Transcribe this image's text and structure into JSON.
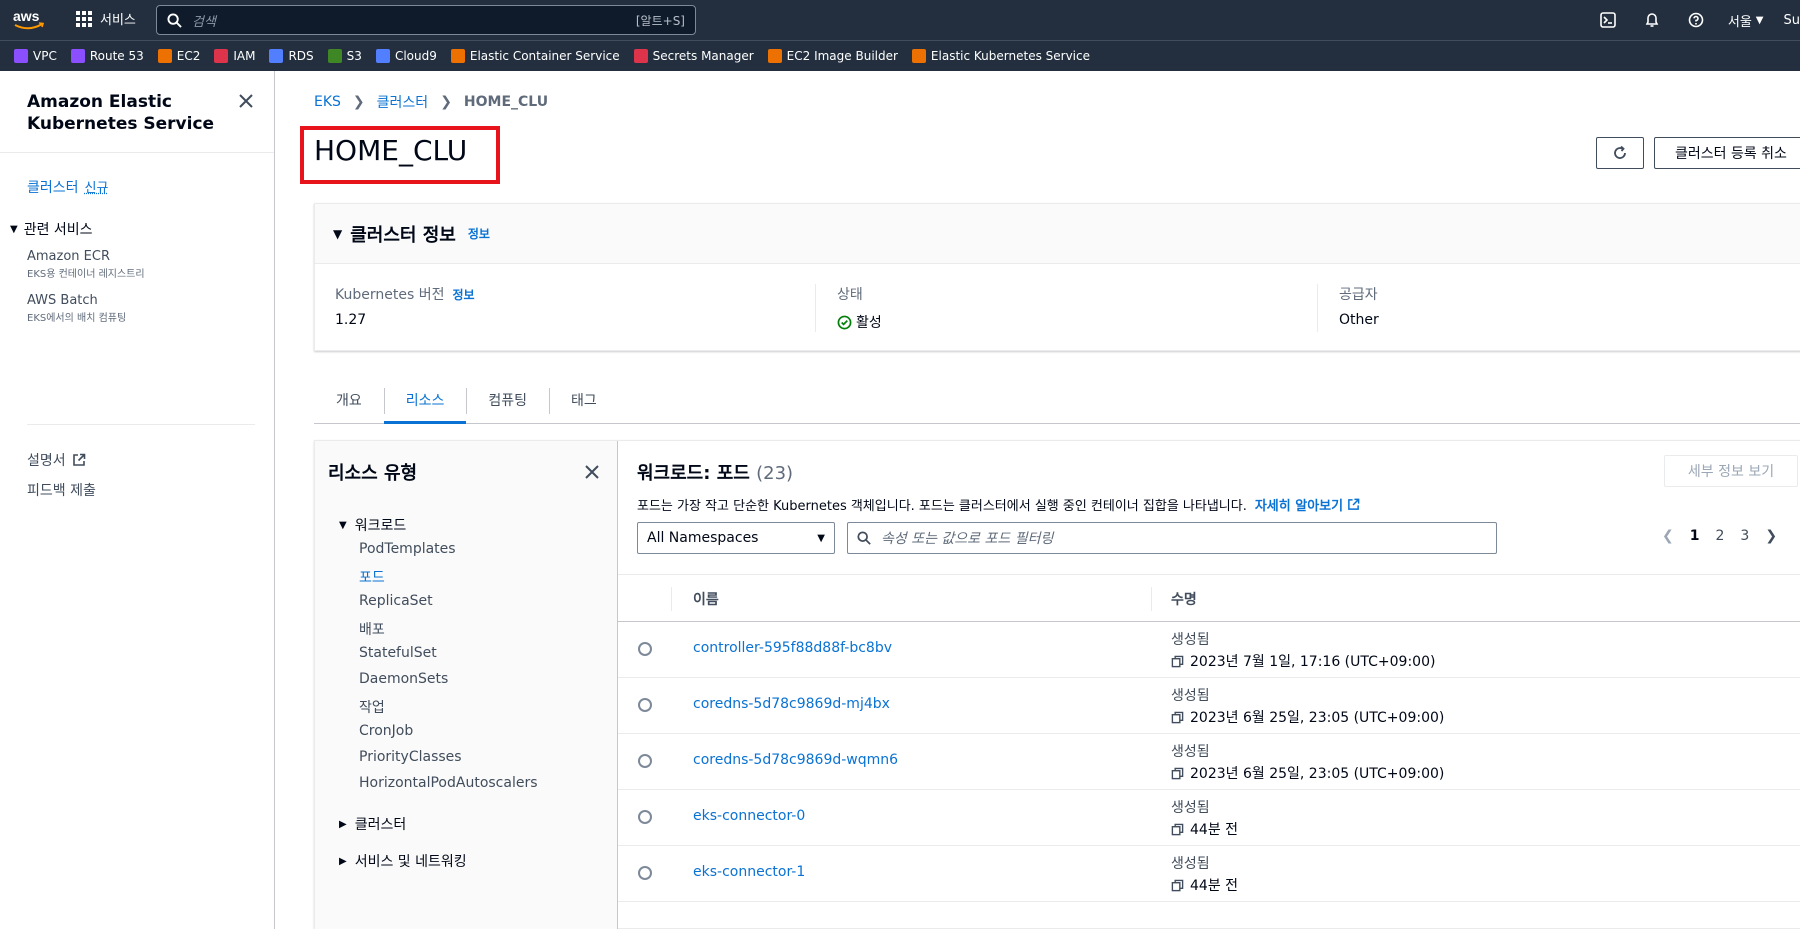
{
  "topnav": {
    "logo_text": "aws",
    "services_label": "서비스",
    "search_placeholder": "검색",
    "search_shortcut": "[알트+S]",
    "region": "서울",
    "account_partial": "Su"
  },
  "favorites": [
    {
      "label": "VPC",
      "color": "#8c4fff"
    },
    {
      "label": "Route 53",
      "color": "#8c4fff"
    },
    {
      "label": "EC2",
      "color": "#ed7100"
    },
    {
      "label": "IAM",
      "color": "#dd344c"
    },
    {
      "label": "RDS",
      "color": "#527fff"
    },
    {
      "label": "S3",
      "color": "#3f8624"
    },
    {
      "label": "Cloud9",
      "color": "#527fff"
    },
    {
      "label": "Elastic Container Service",
      "color": "#ed7100"
    },
    {
      "label": "Secrets Manager",
      "color": "#dd344c"
    },
    {
      "label": "EC2 Image Builder",
      "color": "#ed7100"
    },
    {
      "label": "Elastic Kubernetes Service",
      "color": "#ed7100"
    }
  ],
  "sidenav": {
    "title": "Amazon Elastic Kubernetes Service",
    "cluster_link": "클러스터",
    "new_badge": "신규",
    "related_header": "관련 서비스",
    "related": [
      {
        "label": "Amazon ECR",
        "desc": "EKS용 컨테이너 레지스트리"
      },
      {
        "label": "AWS Batch",
        "desc": "EKS에서의 배치 컴퓨팅"
      }
    ],
    "docs": "설명서",
    "feedback": "피드백 제출"
  },
  "breadcrumb": [
    "EKS",
    "클러스터",
    "HOME_CLU"
  ],
  "page_title": "HOME_CLU",
  "actions": {
    "deregister": "클러스터 등록 취소"
  },
  "cluster_info": {
    "header": "클러스터 정보",
    "info_link": "정보",
    "k8s_version_label": "Kubernetes 버전",
    "k8s_version": "1.27",
    "status_label": "상태",
    "status": "활성",
    "provider_label": "공급자",
    "provider": "Other"
  },
  "tabs": [
    "개요",
    "리소스",
    "컴퓨팅",
    "태그"
  ],
  "active_tab": 1,
  "resource_types": {
    "title": "리소스 유형",
    "workload_group": "워크로드",
    "workload_items": [
      "PodTemplates",
      "포드",
      "ReplicaSet",
      "배포",
      "StatefulSet",
      "DaemonSets",
      "작업",
      "CronJob",
      "PriorityClasses",
      "HorizontalPodAutoscalers"
    ],
    "active_item": 1,
    "collapsed_groups": [
      "클러스터",
      "서비스 및 네트워킹"
    ]
  },
  "pods": {
    "title": "워크로드: 포드",
    "count": "(23)",
    "details_button": "세부 정보 보기",
    "description": "포드는 가장 작고 단순한 Kubernetes 객체입니다. 포드는 클러스터에서 실행 중인 컨테이너 집합을 나타냅니다.",
    "learn_more": "자세히 알아보기",
    "namespace": "All Namespaces",
    "filter_placeholder": "속성 또는 값으로 포드 필터링",
    "pages": [
      "1",
      "2",
      "3"
    ],
    "columns": {
      "name": "이름",
      "age": "수명"
    },
    "rows": [
      {
        "name": "controller-595f88d88f-bc8bv",
        "age_label": "생성됨",
        "age": "2023년 7월 1일, 17:16 (UTC+09:00)"
      },
      {
        "name": "coredns-5d78c9869d-mj4bx",
        "age_label": "생성됨",
        "age": "2023년 6월 25일, 23:05 (UTC+09:00)"
      },
      {
        "name": "coredns-5d78c9869d-wqmn6",
        "age_label": "생성됨",
        "age": "2023년 6월 25일, 23:05 (UTC+09:00)"
      },
      {
        "name": "eks-connector-0",
        "age_label": "생성됨",
        "age": "44분 전"
      },
      {
        "name": "eks-connector-1",
        "age_label": "생성됨",
        "age": "44분 전"
      }
    ]
  }
}
